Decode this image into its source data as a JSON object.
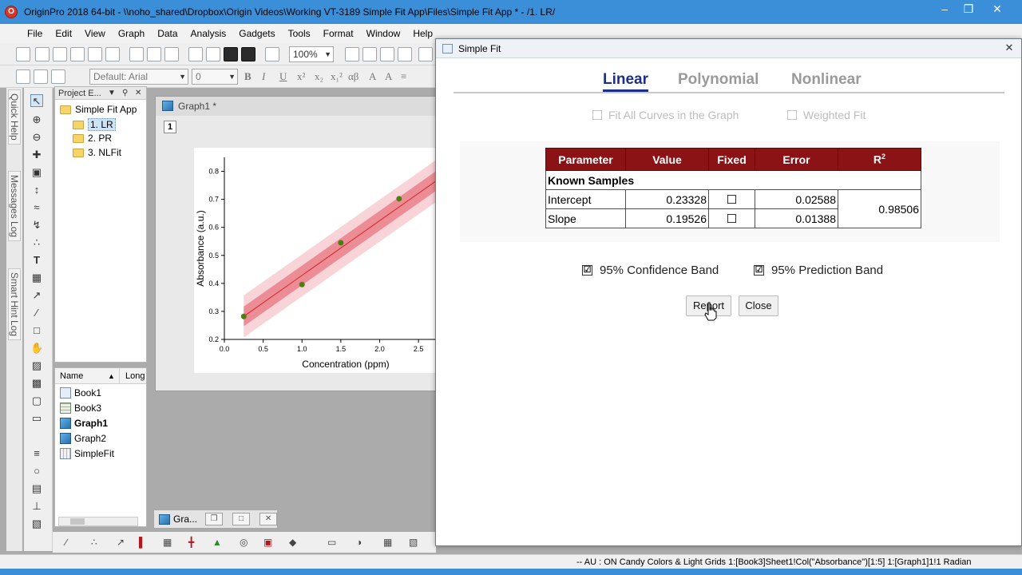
{
  "window": {
    "title": "OriginPro 2018 64-bit - \\\\noho_shared\\Dropbox\\Origin Videos\\Working VT-3189 Simple Fit App\\Files\\Simple Fit App * - /1. LR/",
    "icon_letter": "O"
  },
  "menu": [
    "File",
    "Edit",
    "View",
    "Graph",
    "Data",
    "Analysis",
    "Gadgets",
    "Tools",
    "Format",
    "Window",
    "Help"
  ],
  "toolbar": {
    "zoom": "100%",
    "font_name": "Default: Arial",
    "font_size": "0",
    "format_buttons": [
      "B",
      "I",
      "U",
      "x²",
      "x₂",
      "x₁²",
      "αβ",
      "A",
      "A"
    ]
  },
  "side_tabs": [
    "Quick Help",
    "Messages Log",
    "Smart Hint Log"
  ],
  "project_explorer": {
    "title": "Project E...",
    "root": "Simple Fit App",
    "folders": [
      "1. LR",
      "2. PR",
      "3. NLFit"
    ],
    "selected": "1. LR",
    "columns": [
      "Name",
      "Long"
    ],
    "files": [
      {
        "name": "Book1",
        "kind": "book-icon",
        "bold": false
      },
      {
        "name": "Book3",
        "kind": "book-icon",
        "bold": false
      },
      {
        "name": "Graph1",
        "kind": "graph-icon",
        "bold": true
      },
      {
        "name": "Graph2",
        "kind": "graph-icon",
        "bold": false
      },
      {
        "name": "SimpleFit",
        "kind": "app-icon",
        "bold": false
      }
    ]
  },
  "graph_window": {
    "title": "Graph1 *",
    "layer": "1",
    "minimized_title": "Gra..."
  },
  "chart_data": {
    "type": "scatter",
    "xlabel": "Concentration (ppm)",
    "ylabel": "Absorbance (a.u.)",
    "xlim": [
      0,
      2.9
    ],
    "ylim": [
      0.2,
      0.85
    ],
    "x_ticks": [
      "0.0",
      "0.5",
      "1.0",
      "1.5",
      "2.0",
      "2.5"
    ],
    "y_ticks": [
      "0.2",
      "0.3",
      "0.4",
      "0.5",
      "0.6",
      "0.7",
      "0.8"
    ],
    "x_tick_values": [
      0,
      0.5,
      1.0,
      1.5,
      2.0,
      2.5
    ],
    "y_tick_values": [
      0.2,
      0.3,
      0.4,
      0.5,
      0.6,
      0.7,
      0.8
    ],
    "points": [
      {
        "x": 0.25,
        "y": 0.282
      },
      {
        "x": 1.0,
        "y": 0.396
      },
      {
        "x": 1.5,
        "y": 0.545
      },
      {
        "x": 2.25,
        "y": 0.702
      }
    ],
    "fit": {
      "intercept": 0.23328,
      "slope": 0.19526
    },
    "confidence_band_halfwidth": 0.035,
    "prediction_band_halfwidth": 0.075,
    "colors": {
      "point": "#4e7d12",
      "fit": "#d3232f",
      "confidence": "#ec8d96",
      "prediction": "#f8d3d7"
    }
  },
  "dialog": {
    "title": "Simple Fit",
    "close_label": "✕",
    "tabs": [
      "Linear",
      "Polynomial",
      "Nonlinear"
    ],
    "active_tab": "Linear",
    "options": [
      "Fit All Curves in the Graph",
      "Weighted Fit"
    ],
    "table": {
      "headers": [
        "Parameter",
        "Value",
        "Fixed",
        "Error",
        "R"
      ],
      "r_superscript": "2",
      "group_label": "Known Samples",
      "rows": [
        {
          "param": "Intercept",
          "value": "0.23328",
          "error": "0.02588"
        },
        {
          "param": "Slope",
          "value": "0.19526",
          "error": "0.01388"
        }
      ],
      "r2": "0.98506"
    },
    "bands": [
      "95% Confidence Band",
      "95% Prediction Band"
    ],
    "check_mark": "☑",
    "buttons": {
      "report": "Report",
      "close": "Close"
    }
  },
  "status": {
    "text": "--     AU : ON   Candy Colors & Light Grids   1:[Book3]Sheet1!Col(\"Absorbance\")[1:5]   1:[Graph1]1!1   Radian"
  },
  "colors": {
    "titlebar": "#3a8fd8",
    "header_red": "#8b1316",
    "tab_active": "#1c2f8a"
  }
}
